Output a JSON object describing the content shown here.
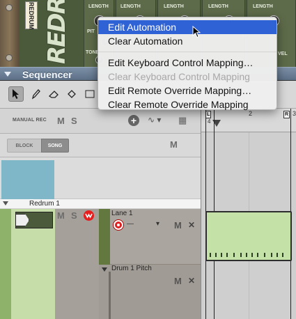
{
  "rack": {
    "device_label": "REDRUM",
    "channel_labels": [
      "LENGTH",
      "LENGTH",
      "LENGTH",
      "LENGTH",
      "LENGTH"
    ],
    "tone_label": "TONE",
    "pitch_label": "PIT",
    "vel_label": "VEL"
  },
  "sequencer": {
    "title": "Sequencer"
  },
  "header": {
    "manual_rec": "MANUAL REC",
    "mute": "M",
    "solo": "S",
    "add_icon": "+",
    "wave_icon": "∿ ▾",
    "grid_icon": "▦"
  },
  "mode": {
    "block": "BLOCK",
    "song": "SONG",
    "mute": "M"
  },
  "track": {
    "name": "Redrum 1",
    "mute": "M",
    "solo": "S",
    "lane": {
      "name": "Lane 1",
      "dash": "—",
      "dropdown": "▾",
      "mute": "M",
      "close": "✕"
    },
    "pitch_lane": {
      "name": "Drum 1 Pitch",
      "mute": "M",
      "close": "✕"
    }
  },
  "ruler": {
    "ticks": [
      "2",
      "3"
    ],
    "left_marker": "L",
    "right_marker": "R",
    "loop_start": "4",
    "left_small": "Г"
  },
  "context_menu": {
    "items": [
      {
        "label": "Edit Automation",
        "state": "highlighted"
      },
      {
        "label": "Clear Automation",
        "state": "enabled"
      },
      {
        "label": "Edit Keyboard Control Mapping…",
        "state": "enabled"
      },
      {
        "label": "Clear Keyboard Control Mapping",
        "state": "disabled"
      },
      {
        "label": "Edit Remote Override Mapping…",
        "state": "enabled"
      },
      {
        "label": "Clear Remote Override Mapping",
        "state": "enabled"
      }
    ]
  },
  "colors": {
    "menu_highlight": "#2f62d4",
    "clip": "#c4e2a8",
    "record": "#e02020",
    "track_tile": "#c6dca9",
    "sequencer_title_bar": "#6a7d94"
  }
}
